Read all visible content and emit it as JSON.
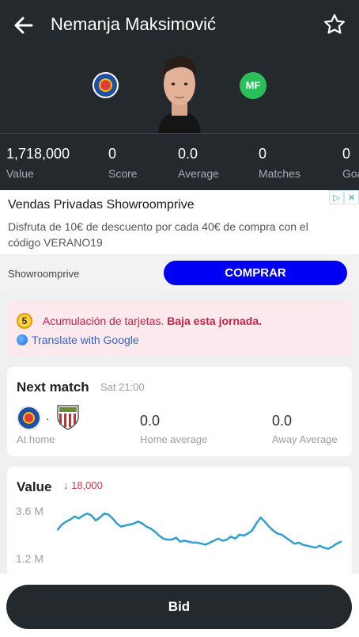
{
  "header": {
    "title": "Nemanja Maksimović",
    "position_badge": "MF",
    "icons": {
      "back": "arrow-left-icon",
      "favorite": "star-outline-icon",
      "club": "getafe-badge-icon"
    }
  },
  "stats": [
    {
      "value": "1,718,000",
      "label": "Value"
    },
    {
      "value": "0",
      "label": "Score"
    },
    {
      "value": "0.0",
      "label": "Average"
    },
    {
      "value": "0",
      "label": "Matches"
    },
    {
      "value": "0",
      "label": "Goals"
    }
  ],
  "ad": {
    "title": "Vendas Privadas Showroomprive",
    "text": "Disfruta de 10€ de descuento por cada 40€ de compra con el código VERANO19",
    "brand": "Showroomprive",
    "cta": "COMPRAR",
    "cta_color": "#0000f5"
  },
  "alert": {
    "badge": "5",
    "text": "Acumulación de tarjetas.",
    "emphasis": "Baja esta jornada.",
    "translate": "Translate with Google"
  },
  "next_match": {
    "title": "Next match",
    "time": "Sat 21:00",
    "separator": "·",
    "home_label": "At home",
    "home_average": "0.0",
    "home_average_label": "Home average",
    "away_average": "0.0",
    "away_average_label": "Away Average"
  },
  "value_card": {
    "title": "Value",
    "delta": "↓ 18,000",
    "y_top": "3.6 M",
    "y_bottom": "1.2 M",
    "line_color": "#2f9fd0"
  },
  "chart_data": {
    "type": "line",
    "title": "",
    "ylim": [
      1.2,
      3.6
    ],
    "series": [
      {
        "values": [
          2.6,
          2.85,
          3.0,
          3.1,
          3.25,
          3.15,
          3.3,
          3.4,
          3.3,
          3.05,
          3.2,
          3.4,
          3.35,
          3.15,
          2.9,
          2.75,
          2.8,
          2.85,
          2.9,
          3.0,
          2.9,
          2.75,
          2.65,
          2.5,
          2.3,
          2.15,
          2.1,
          2.1,
          2.2,
          2.0,
          2.05,
          2.0,
          1.95,
          1.95,
          1.9,
          1.85,
          1.95,
          2.05,
          2.15,
          2.05,
          2.1,
          2.25,
          2.15,
          2.35,
          2.3,
          2.4,
          2.55,
          2.9,
          3.2,
          3.0,
          2.75,
          2.55,
          2.4,
          2.35,
          2.2,
          2.05,
          1.9,
          1.95,
          1.85,
          1.8,
          1.75,
          1.7,
          1.8,
          1.7,
          1.65,
          1.75,
          1.9,
          2.0
        ]
      }
    ]
  },
  "footer": {
    "bid_label": "Bid"
  }
}
